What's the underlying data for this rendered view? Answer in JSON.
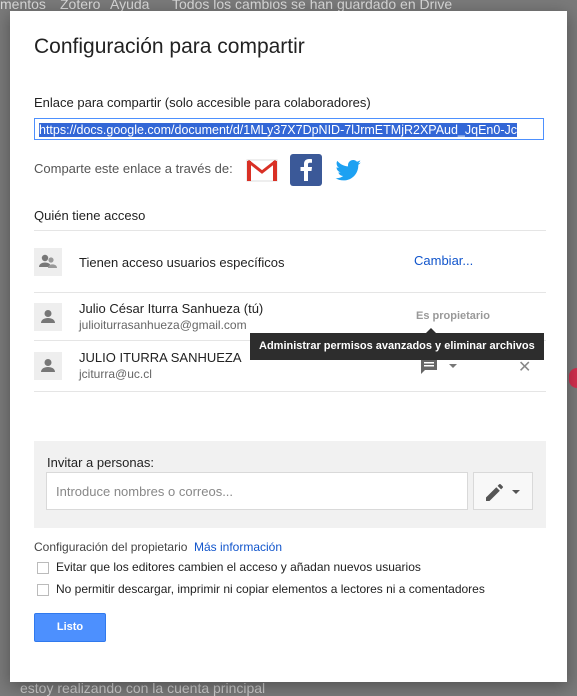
{
  "background": {
    "top_items": [
      "mentos",
      "Zotero",
      "Ayuda",
      "Todos los cambios se han guardado en Drive"
    ],
    "bottom_text": "estoy realizando con la cuenta principal"
  },
  "dialog": {
    "title": "Configuración para compartir",
    "link_label": "Enlace para compartir (solo accesible para colaboradores)",
    "link_value": "https://docs.google.com/document/d/1MLy37X7DpNID-7lJrmETMjR2XPAud_JqEn0-Jc",
    "share_via_label": "Comparte este enlace a través de:",
    "share_icons": [
      "gmail-icon",
      "facebook-icon",
      "twitter-icon"
    ],
    "access_label": "Quién tiene acceso",
    "access_rows": [
      {
        "name": "Tienen acceso usuarios específicos",
        "action": "Cambiar..."
      },
      {
        "name": "Julio César Iturra Sanhueza (tú)",
        "email": "julioiturrasanhueza@gmail.com",
        "role": "Es propietario"
      },
      {
        "name": "JULIO ITURRA SANHUEZA",
        "email": "jciturra@uc.cl"
      }
    ],
    "tooltip": "Administrar permisos avanzados y eliminar archivos",
    "invite": {
      "label": "Invitar a personas:",
      "placeholder": "Introduce nombres o correos..."
    },
    "owner_settings": {
      "label": "Configuración del propietario",
      "more_info": "Más información",
      "options": [
        "Evitar que los editores cambien el acceso y añadan nuevos usuarios",
        "No permitir descargar, imprimir ni copiar elementos a lectores ni a comentadores"
      ]
    },
    "done_label": "Listo"
  },
  "colors": {
    "accent": "#4d90fe",
    "link": "#1155cc",
    "facebook": "#3b5998",
    "twitter": "#1da1f2",
    "tooltip_bg": "#2d2d2d"
  }
}
